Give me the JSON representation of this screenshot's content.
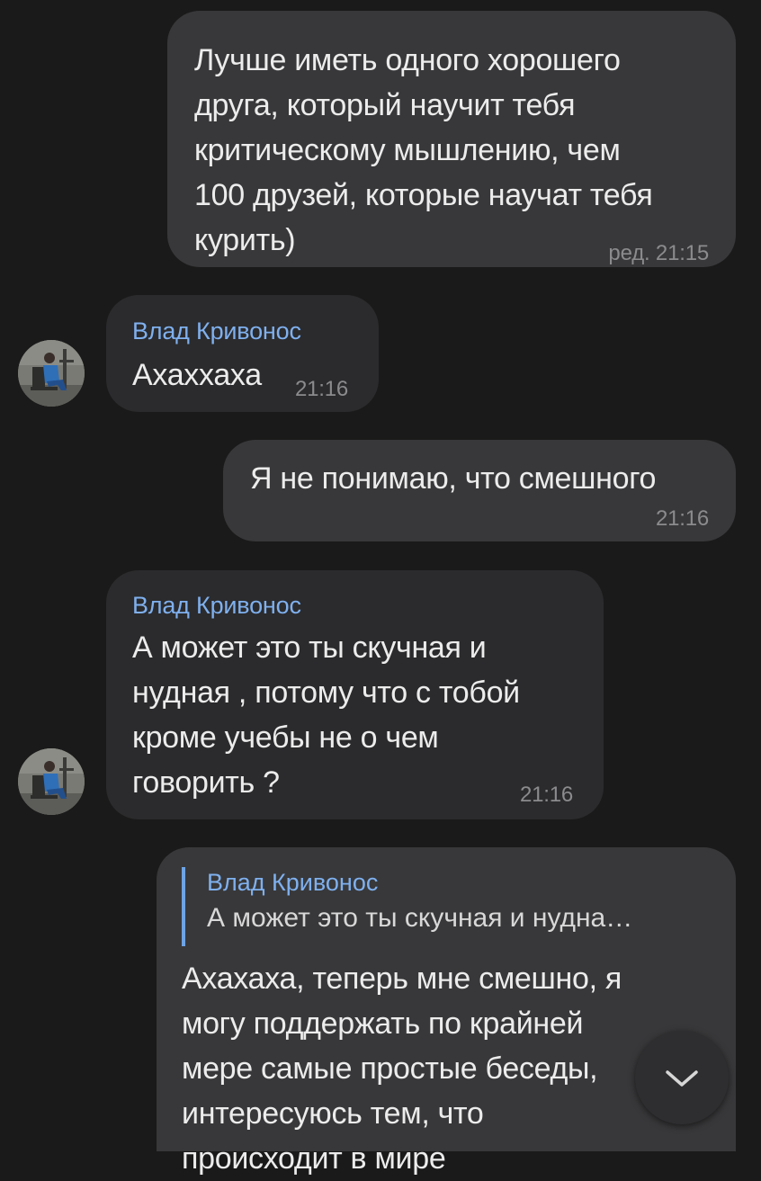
{
  "messages": [
    {
      "direction": "outgoing",
      "text": "Лучше иметь одного хорошего\nдруга, который научит тебя\nкритическому мышлению, чем\n100 друзей, которые научат тебя\nкурить)",
      "time": "ред. 21:15"
    },
    {
      "direction": "incoming",
      "sender": "Влад Кривонос",
      "text": "Ахаххаха",
      "time": "21:16"
    },
    {
      "direction": "outgoing",
      "text": "Я не понимаю, что смешного",
      "time": "21:16"
    },
    {
      "direction": "incoming",
      "sender": "Влад Кривонос",
      "text": "А может это ты скучная и\nнудная , потому что с тобой\nкроме учебы не о чем\nговорить ?",
      "time": "21:16"
    },
    {
      "direction": "outgoing",
      "reply_to": {
        "sender": "Влад Кривонос",
        "text": "А может это ты скучная и нудна…"
      },
      "text": "Ахахаха, теперь мне смешно, я\nмогу поддержать по крайней\nмере самые простые беседы,\nинтересуюсь тем, что\nпроисходит в мире"
    }
  ],
  "scroll_button": {
    "icon": "chevron-down-icon"
  },
  "colors": {
    "background": "#1a1a1a",
    "outgoing_bubble": "#38383a",
    "incoming_bubble": "#2b2b2d",
    "sender_name": "#7fb0ee",
    "reply_bar": "#6ea3e4",
    "time": "#8b8b8e"
  }
}
